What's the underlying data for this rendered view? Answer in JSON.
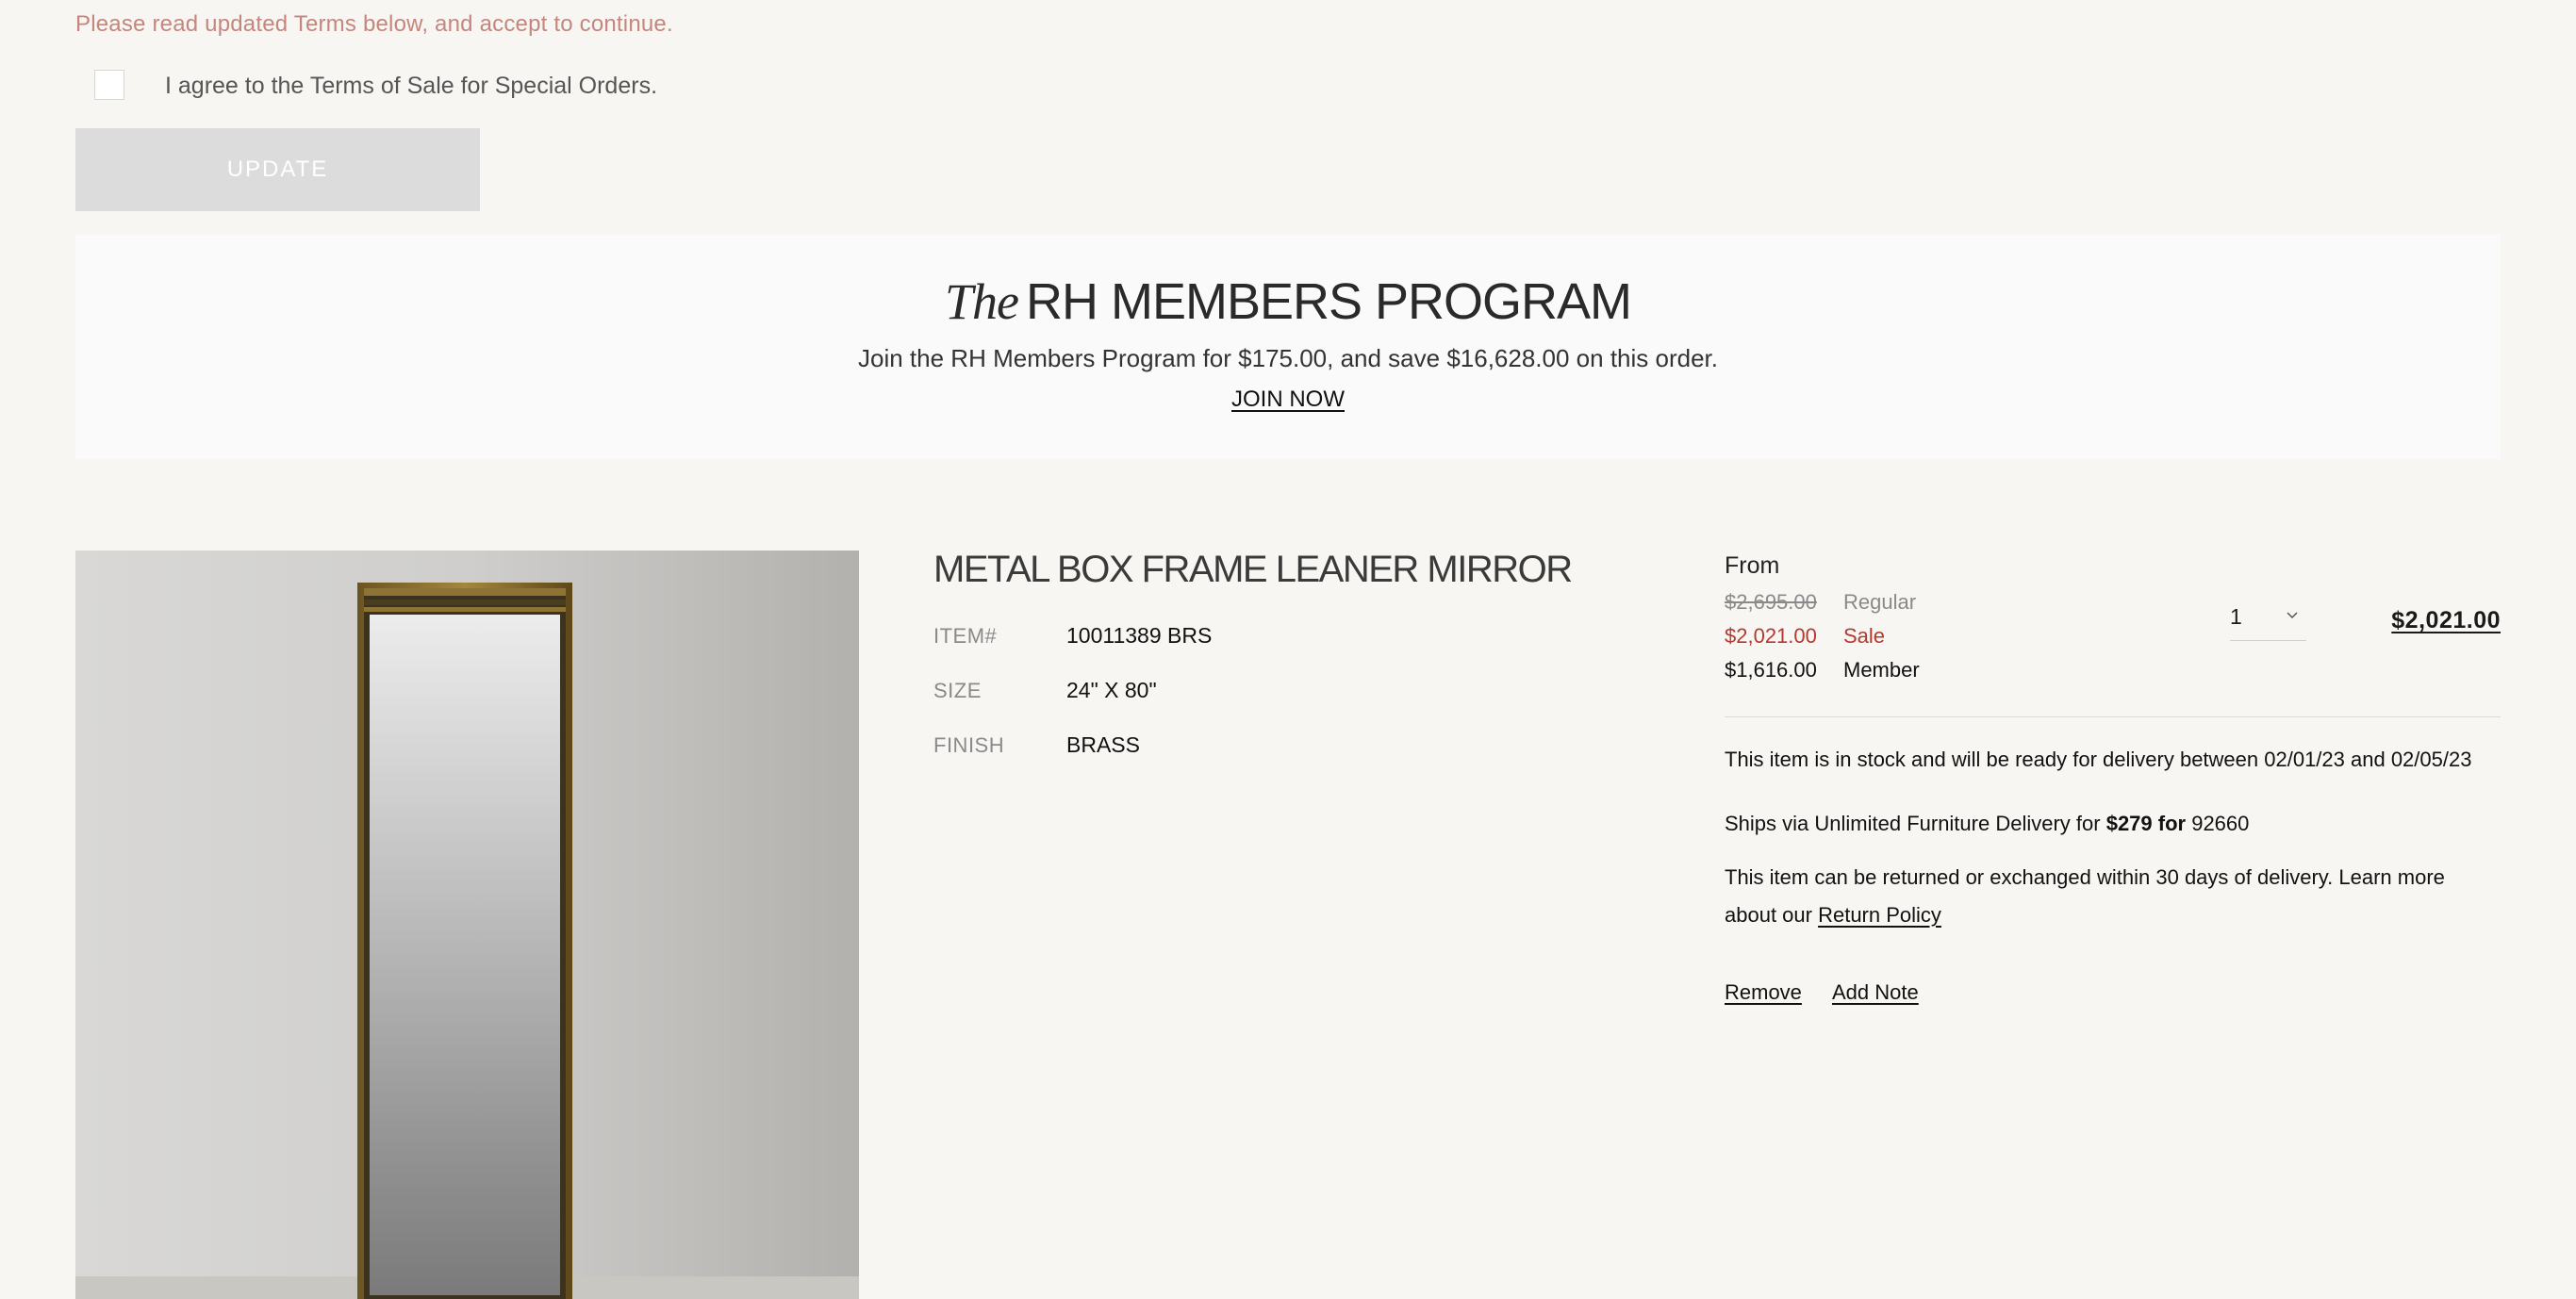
{
  "terms": {
    "warning": "Please read updated Terms below, and accept to continue.",
    "agree_label": "I agree to the Terms of Sale for Special Orders.",
    "update_label": "UPDATE"
  },
  "members": {
    "title_italic": "The",
    "title_main": "RH MEMBERS PROGRAM",
    "subtitle": "Join the RH Members Program for $175.00, and save $16,628.00 on this order.",
    "join_label": "JOIN NOW"
  },
  "product": {
    "name": "METAL BOX FRAME LEANER MIRROR",
    "specs": [
      {
        "label": "ITEM#",
        "value": "10011389 BRS"
      },
      {
        "label": "SIZE",
        "value": "24\" X 80\""
      },
      {
        "label": "FINISH",
        "value": "BRASS"
      }
    ]
  },
  "pricing": {
    "from_label": "From",
    "regular_price": "$2,695.00",
    "regular_label": "Regular",
    "sale_price": "$2,021.00",
    "sale_label": "Sale",
    "member_price": "$1,616.00",
    "member_label": "Member",
    "quantity": "1",
    "line_total": "$2,021.00"
  },
  "delivery": {
    "stock_text": "This item is in stock and will be ready for delivery between 02/01/23 and 02/05/23",
    "ships_prefix": "Ships via Unlimited Furniture Delivery for ",
    "ships_price": "$279 for",
    "ships_zip": " 92660",
    "returns_text": "This item can be returned or exchanged within 30 days of delivery.  Learn more about our ",
    "return_policy_label": "Return Policy"
  },
  "actions": {
    "remove_label": "Remove",
    "add_note_label": "Add Note"
  },
  "colors": {
    "background": "#f7f6f3",
    "warning": "#c4867d",
    "sale": "#b23a2e",
    "update_disabled": "#dcdcdc"
  }
}
